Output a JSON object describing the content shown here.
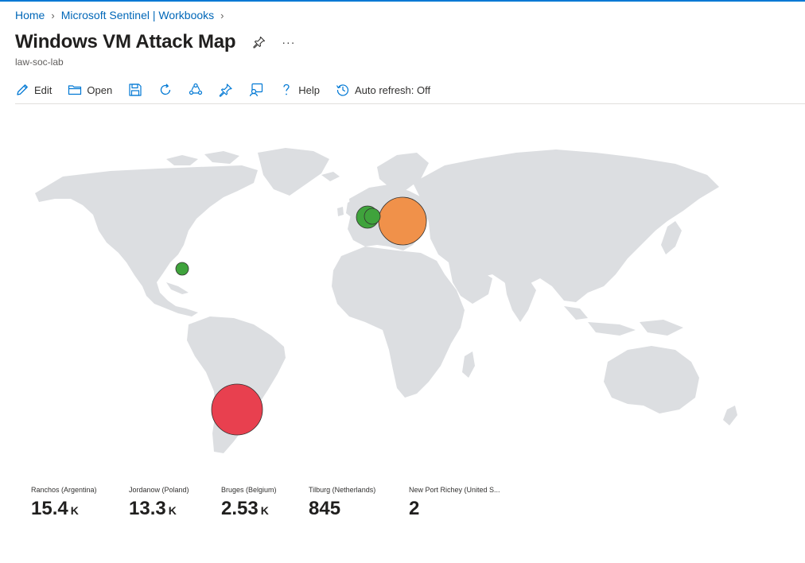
{
  "breadcrumb": {
    "home": "Home",
    "parent": "Microsoft Sentinel | Workbooks"
  },
  "header": {
    "title": "Windows VM Attack Map",
    "subtitle": "law-soc-lab",
    "more": "···"
  },
  "toolbar": {
    "edit": "Edit",
    "open": "Open",
    "help": "Help",
    "auto_refresh": "Auto refresh: Off",
    "icons": [
      "edit-icon",
      "open-folder-icon",
      "save-icon",
      "refresh-icon",
      "share-icon",
      "pin-icon",
      "customize-icon",
      "help-icon",
      "history-icon"
    ]
  },
  "map": {
    "land_color": "#dcdee1",
    "markers": [
      {
        "location": "Ranchos (Argentina)",
        "color": "#e8404f"
      },
      {
        "location": "Jordanow (Poland)",
        "color": "#f0914a"
      },
      {
        "location": "Bruges (Belgium)",
        "color": "#3fa33c"
      },
      {
        "location": "Tilburg (Netherlands)",
        "color": "#3fa33c"
      },
      {
        "location": "New Port Richey (United S...",
        "color": "#3fa33c"
      }
    ]
  },
  "stats": [
    {
      "label": "Ranchos (Argentina)",
      "value": "15.4",
      "unit": "K"
    },
    {
      "label": "Jordanow (Poland)",
      "value": "13.3",
      "unit": "K"
    },
    {
      "label": "Bruges (Belgium)",
      "value": "2.53",
      "unit": "K"
    },
    {
      "label": "Tilburg (Netherlands)",
      "value": "845",
      "unit": ""
    },
    {
      "label": "New Port Richey (United S...",
      "value": "2",
      "unit": ""
    }
  ],
  "colors": {
    "accent": "#0078d4",
    "link": "#0067b8"
  }
}
